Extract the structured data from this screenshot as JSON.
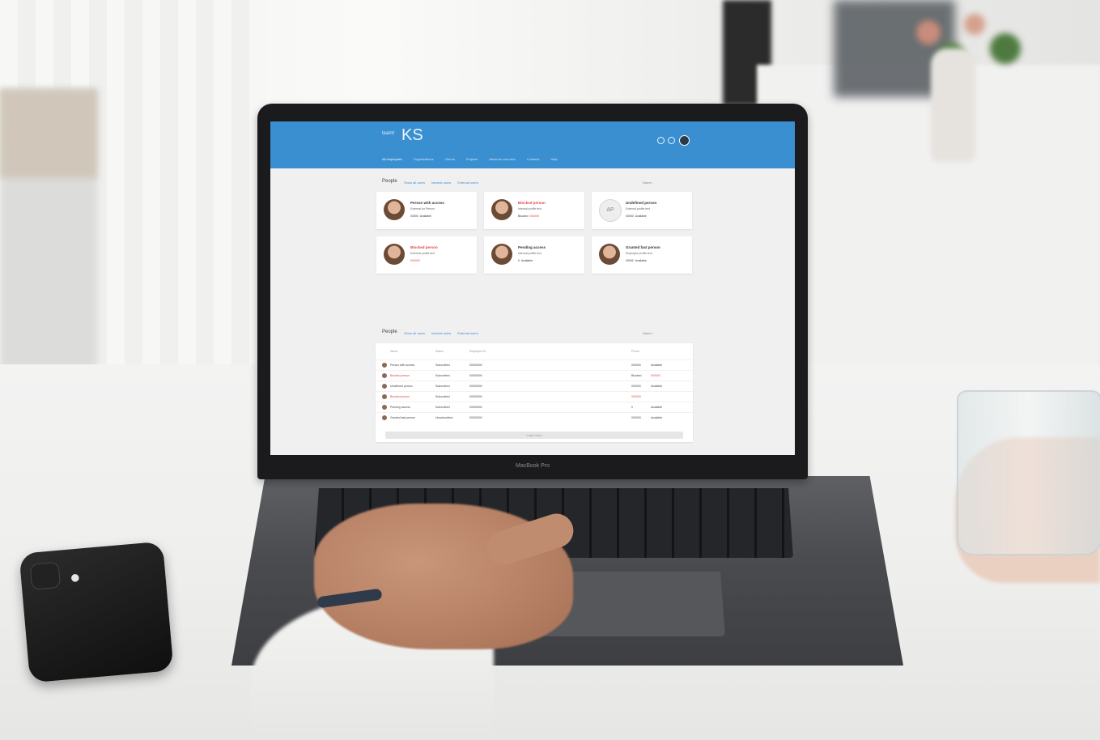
{
  "laptop": {
    "model_label": "MacBook Pro"
  },
  "app": {
    "brand_small": "teamt",
    "brand": "KS",
    "nav": [
      "All employees",
      "Organizations",
      "Clients",
      "Projects",
      "Absence overview",
      "Contacts",
      "Help"
    ],
    "people_section": {
      "title": "People",
      "filters": [
        "Show all users",
        "Internal users",
        "External users"
      ],
      "sort_label": "Name ↓"
    },
    "cards": [
      {
        "name": "Person with access",
        "subtitle": "External for Person",
        "meta": "00000",
        "status": "Available",
        "red": false,
        "initials": ""
      },
      {
        "name": "Blocked person",
        "subtitle": "Internal profile text",
        "meta": "Blocked",
        "status": "000000",
        "red": true,
        "initials": ""
      },
      {
        "name": "Undefined person",
        "subtitle": "External profile text",
        "meta": "00000",
        "status": "Available",
        "red": false,
        "initials": "AP"
      },
      {
        "name": "Blocked person",
        "subtitle": "External profile text",
        "meta": "000000",
        "status": "",
        "red": true,
        "initials": ""
      },
      {
        "name": "Pending access",
        "subtitle": "Internal profile text",
        "meta": "0",
        "status": "Available",
        "red": false,
        "initials": ""
      },
      {
        "name": "Granted fast person",
        "subtitle": "Employee profile text",
        "meta": "00000",
        "status": "Available",
        "red": false,
        "initials": ""
      }
    ],
    "people_list": {
      "title": "People",
      "filters": [
        "Show all users",
        "Internal users",
        "External users"
      ],
      "sort_label": "Name ↓",
      "columns": [
        "Name",
        "Status",
        "Employee ID",
        "Phone"
      ],
      "rows": [
        {
          "name": "Person with access",
          "status": "Subscribed",
          "id": "00000000",
          "phone": "000000",
          "extra": "Available",
          "red": false
        },
        {
          "name": "Blocked person",
          "status": "Subscribed",
          "id": "00000000",
          "phone": "Blocked",
          "extra": "000000",
          "red": true
        },
        {
          "name": "Undefined person",
          "status": "Subscribed",
          "id": "00000000",
          "phone": "000000",
          "extra": "Available",
          "red": false
        },
        {
          "name": "Blocked person",
          "status": "Subscribed",
          "id": "00000000",
          "phone": "000000",
          "extra": "",
          "red": true
        },
        {
          "name": "Pending access",
          "status": "Subscribed",
          "id": "00000000",
          "phone": "0",
          "extra": "Available",
          "red": false
        },
        {
          "name": "Granted fast person",
          "status": "Unsubscribed",
          "id": "00000000",
          "phone": "000000",
          "extra": "Available",
          "red": false
        }
      ],
      "load_more": "Load more"
    }
  }
}
